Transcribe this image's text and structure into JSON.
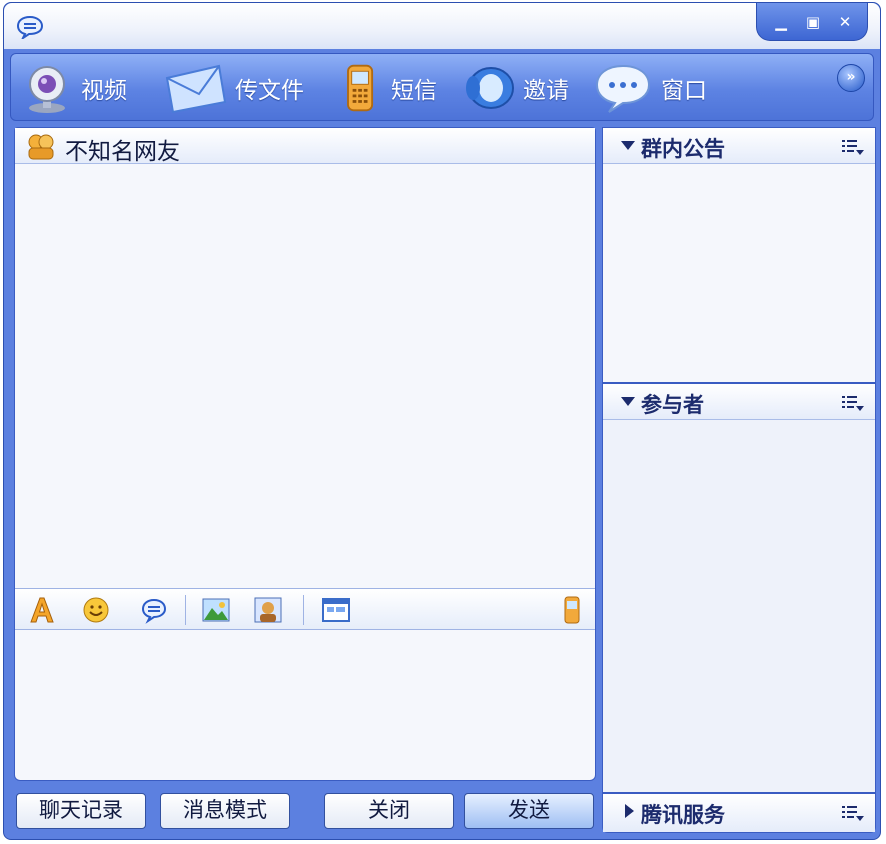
{
  "window": {
    "controls": [
      "minimize",
      "maximize",
      "close"
    ]
  },
  "toolbar": {
    "items": [
      {
        "label": "视频",
        "icon": "webcam-icon"
      },
      {
        "label": "传文件",
        "icon": "envelope-icon"
      },
      {
        "label": "短信",
        "icon": "mobile-phone-icon"
      },
      {
        "label": "邀请",
        "icon": "invite-icon"
      },
      {
        "label": "窗口",
        "icon": "speech-bubble-icon"
      }
    ]
  },
  "chat": {
    "contact_name": "不知名网友",
    "messages": [],
    "input_value": ""
  },
  "format_bar": {
    "icons": [
      "font-icon",
      "emoji-icon",
      "message-icon",
      "image-icon",
      "avatar-icon",
      "screenshot-icon",
      "mobile-icon"
    ]
  },
  "sidebar": {
    "announcement_title": "群内公告",
    "participants_title": "参与者",
    "services_title": "腾讯服务"
  },
  "buttons": {
    "history": "聊天记录",
    "message_mode": "消息模式",
    "close": "关闭",
    "send": "发送"
  },
  "colors": {
    "frame": "#5c80e0",
    "toolbar": "#6b8fe9",
    "panel_bg": "#f5f7fc",
    "title_text": "#1c2b6d"
  }
}
